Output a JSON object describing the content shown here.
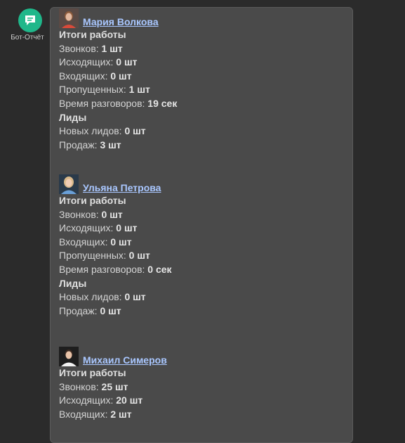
{
  "bot": {
    "name": "Бот-Отчёт",
    "avatar_icon": "chat-bubble-icon",
    "avatar_color": "#1fb78a"
  },
  "people": [
    {
      "name": "Мария Волкова",
      "heading_work": "Итоги работы",
      "calls_label": "Звонков:",
      "calls_value": "1 шт",
      "outgoing_label": "Исходящих:",
      "outgoing_value": "0 шт",
      "incoming_label": "Входящих:",
      "incoming_value": "0 шт",
      "missed_label": "Пропущенных:",
      "missed_value": "1 шт",
      "talk_label": "Время разговоров:",
      "talk_value": "19 сек",
      "heading_leads": "Лиды",
      "new_leads_label": "Новых лидов:",
      "new_leads_value": "0 шт",
      "sales_label": "Продаж:",
      "sales_value": "3 шт"
    },
    {
      "name": "Ульяна Петрова",
      "heading_work": "Итоги работы",
      "calls_label": "Звонков:",
      "calls_value": "0 шт",
      "outgoing_label": "Исходящих:",
      "outgoing_value": "0 шт",
      "incoming_label": "Входящих:",
      "incoming_value": "0 шт",
      "missed_label": "Пропущенных:",
      "missed_value": "0 шт",
      "talk_label": "Время разговоров:",
      "talk_value": "0 сек",
      "heading_leads": "Лиды",
      "new_leads_label": "Новых лидов:",
      "new_leads_value": "0 шт",
      "sales_label": "Продаж:",
      "sales_value": "0 шт"
    },
    {
      "name": "Михаил Симеров",
      "heading_work": "Итоги работы",
      "calls_label": "Звонков:",
      "calls_value": "25 шт",
      "outgoing_label": "Исходящих:",
      "outgoing_value": "20 шт",
      "incoming_label": "Входящих:",
      "incoming_value": "2 шт"
    }
  ],
  "colors": {
    "background": "#2b2b2b",
    "message_bg": "#4a4a4a",
    "link": "#a9c7ff",
    "text": "#d4d4d4"
  }
}
